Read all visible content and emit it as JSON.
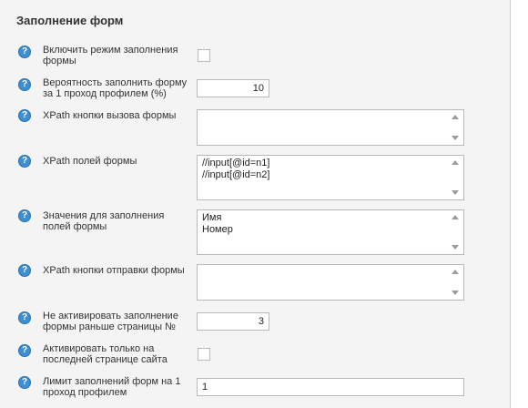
{
  "section": {
    "title": "Заполнение форм"
  },
  "fields": {
    "enable_mode": {
      "label": "Включить режим заполнения формы",
      "checked": false
    },
    "probability": {
      "label": "Вероятность заполнить форму за 1 проход профилем (%)",
      "value": "10"
    },
    "xpath_open_button": {
      "label": "XPath кнопки вызова формы",
      "value": ""
    },
    "xpath_fields": {
      "label": "XPath полей формы",
      "value": "//input[@id=n1]\n//input[@id=n2]"
    },
    "field_values": {
      "label": "Значения для заполнения полей формы",
      "value": "Имя\nНомер"
    },
    "xpath_submit_button": {
      "label": "XPath кнопки отправки формы",
      "value": ""
    },
    "min_page": {
      "label": "Не активировать заполнение формы раньше страницы №",
      "value": "3"
    },
    "last_page_only": {
      "label": "Активировать только на последней странице сайта",
      "checked": false
    },
    "fill_limit": {
      "label": "Лимит заполнений форм на 1 проход профилем",
      "value": "1"
    }
  },
  "icons": {
    "help": "help-question-icon"
  },
  "colors": {
    "help_icon": "#3d8fd6",
    "panel_bg": "#f4f4f4"
  }
}
